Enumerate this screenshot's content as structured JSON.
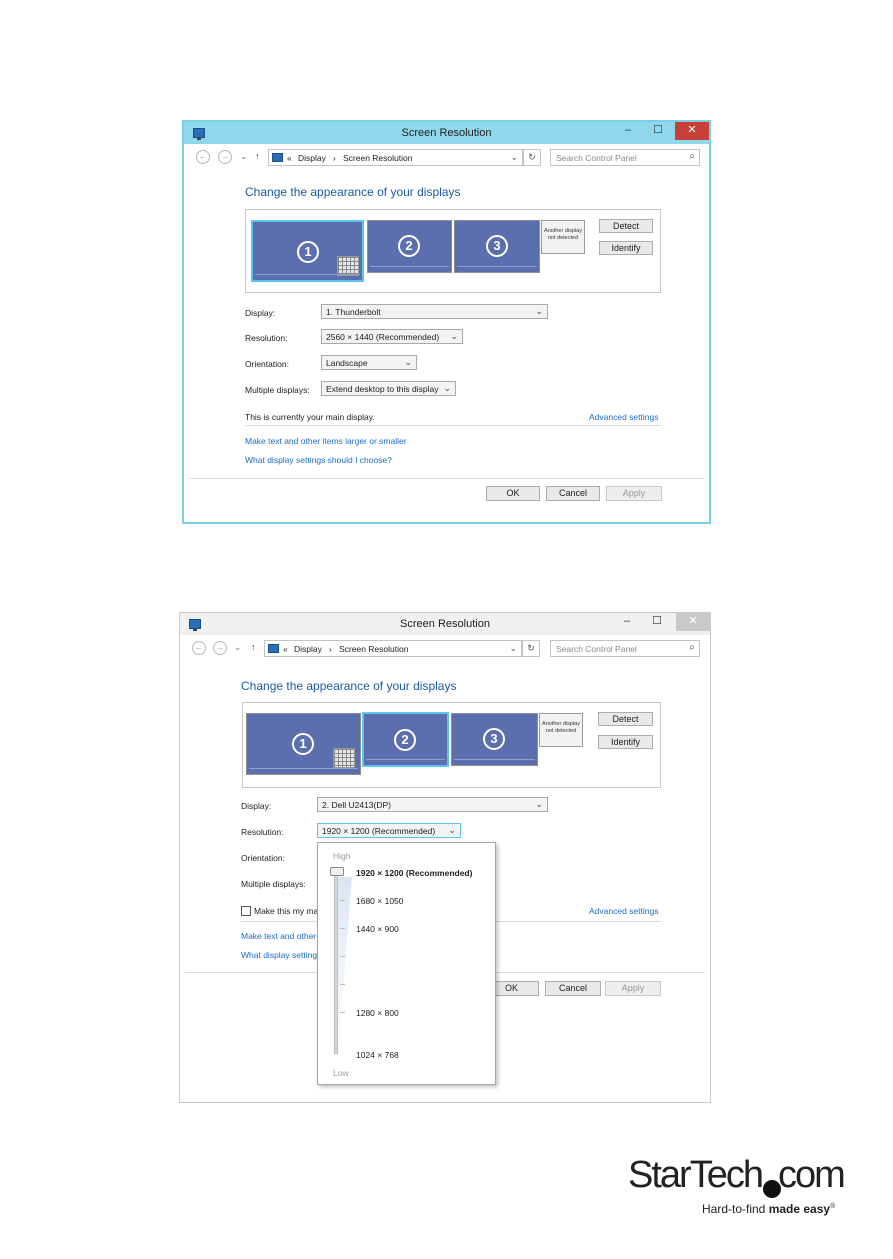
{
  "window_title": "Screen Resolution",
  "controls": {
    "minimize": "–",
    "maximize": "☐",
    "close": "✕"
  },
  "nav": {
    "back": "←",
    "forward": "→",
    "recent": "⌄",
    "up": "↑",
    "chevrons": "«",
    "crumb1": "Display",
    "sep": "›",
    "crumb2": "Screen Resolution",
    "dropdown": "⌄",
    "refresh": "↻"
  },
  "search": {
    "placeholder": "Search Control Panel",
    "icon": "⌕"
  },
  "heading": "Change the appearance of your displays",
  "monitors": {
    "m1": "1",
    "m2": "2",
    "m3": "3",
    "no_display_line1": "Another display",
    "no_display_line2": "not detected"
  },
  "buttons": {
    "detect": "Detect",
    "identify": "Identify",
    "ok": "OK",
    "cancel": "Cancel",
    "apply": "Apply"
  },
  "labels": {
    "display": "Display:",
    "resolution": "Resolution:",
    "orientation": "Orientation:",
    "multiple": "Multiple displays:"
  },
  "screen1": {
    "display_value": "1. Thunderbolt",
    "resolution_value": "2560 × 1440 (Recommended)",
    "orientation_value": "Landscape",
    "multiple_value": "Extend desktop to this display",
    "main_display_note": "This is currently your main display.",
    "advanced": "Advanced settings",
    "link_text_size": "Make text and other items larger or smaller",
    "link_which": "What display settings should I choose?"
  },
  "screen2": {
    "display_value": "2. Dell U2413(DP)",
    "resolution_value": "1920 × 1200 (Recommended)",
    "checkbox_label": "Make this my ma",
    "advanced": "Advanced settings",
    "link_text_size": "Make text and other",
    "link_which": "What display setting"
  },
  "resolution_dropdown": {
    "high": "High",
    "low": "Low",
    "options": [
      "1920 × 1200 (Recommended)",
      "1680 × 1050",
      "1440 × 900",
      "1280 × 800",
      "1024 × 768"
    ],
    "selected": "1920 × 1200 (Recommended)"
  },
  "brand": {
    "word": "StarTech",
    "com": "com",
    "tag_plain": "Hard-to-find ",
    "tag_bold": "made easy",
    "reg": "®"
  }
}
